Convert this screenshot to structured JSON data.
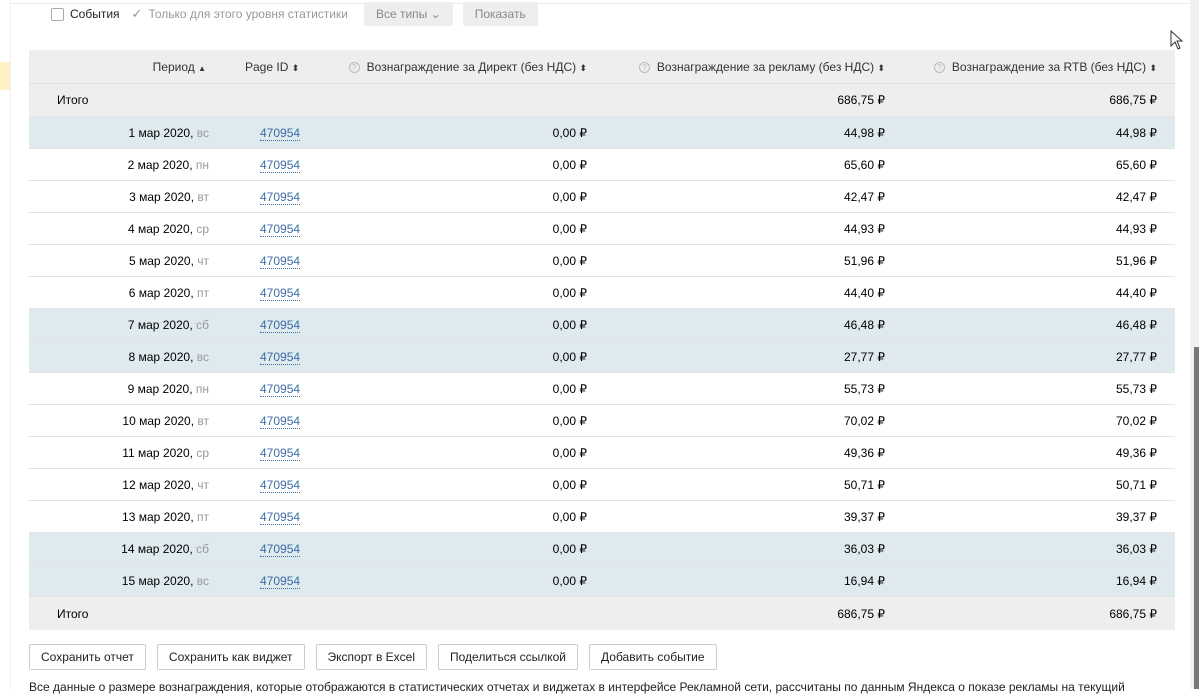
{
  "filters": {
    "events_label": "События",
    "only_level_label": "Только для этого уровня статистики",
    "types_select": "Все типы",
    "show_button": "Показать"
  },
  "table": {
    "headers": {
      "period": "Период",
      "page_id": "Page ID",
      "direct": "Вознаграждение за Директ (без НДС)",
      "ads": "Вознаграждение за рекламу (без НДС)",
      "rtb": "Вознаграждение за RTB (без НДС)"
    },
    "total": {
      "label": "Итого",
      "direct": "",
      "ads": "686,75 ₽",
      "rtb": "686,75 ₽"
    },
    "rows": [
      {
        "date": "1 мар 2020",
        "wd": "вс",
        "page_id": "470954",
        "direct": "0,00 ₽",
        "ads": "44,98 ₽",
        "rtb": "44,98 ₽",
        "weekend": true
      },
      {
        "date": "2 мар 2020",
        "wd": "пн",
        "page_id": "470954",
        "direct": "0,00 ₽",
        "ads": "65,60 ₽",
        "rtb": "65,60 ₽",
        "weekend": false
      },
      {
        "date": "3 мар 2020",
        "wd": "вт",
        "page_id": "470954",
        "direct": "0,00 ₽",
        "ads": "42,47 ₽",
        "rtb": "42,47 ₽",
        "weekend": false
      },
      {
        "date": "4 мар 2020",
        "wd": "ср",
        "page_id": "470954",
        "direct": "0,00 ₽",
        "ads": "44,93 ₽",
        "rtb": "44,93 ₽",
        "weekend": false
      },
      {
        "date": "5 мар 2020",
        "wd": "чт",
        "page_id": "470954",
        "direct": "0,00 ₽",
        "ads": "51,96 ₽",
        "rtb": "51,96 ₽",
        "weekend": false
      },
      {
        "date": "6 мар 2020",
        "wd": "пт",
        "page_id": "470954",
        "direct": "0,00 ₽",
        "ads": "44,40 ₽",
        "rtb": "44,40 ₽",
        "weekend": false
      },
      {
        "date": "7 мар 2020",
        "wd": "сб",
        "page_id": "470954",
        "direct": "0,00 ₽",
        "ads": "46,48 ₽",
        "rtb": "46,48 ₽",
        "weekend": true
      },
      {
        "date": "8 мар 2020",
        "wd": "вс",
        "page_id": "470954",
        "direct": "0,00 ₽",
        "ads": "27,77 ₽",
        "rtb": "27,77 ₽",
        "weekend": true
      },
      {
        "date": "9 мар 2020",
        "wd": "пн",
        "page_id": "470954",
        "direct": "0,00 ₽",
        "ads": "55,73 ₽",
        "rtb": "55,73 ₽",
        "weekend": false
      },
      {
        "date": "10 мар 2020",
        "wd": "вт",
        "page_id": "470954",
        "direct": "0,00 ₽",
        "ads": "70,02 ₽",
        "rtb": "70,02 ₽",
        "weekend": false
      },
      {
        "date": "11 мар 2020",
        "wd": "ср",
        "page_id": "470954",
        "direct": "0,00 ₽",
        "ads": "49,36 ₽",
        "rtb": "49,36 ₽",
        "weekend": false
      },
      {
        "date": "12 мар 2020",
        "wd": "чт",
        "page_id": "470954",
        "direct": "0,00 ₽",
        "ads": "50,71 ₽",
        "rtb": "50,71 ₽",
        "weekend": false
      },
      {
        "date": "13 мар 2020",
        "wd": "пт",
        "page_id": "470954",
        "direct": "0,00 ₽",
        "ads": "39,37 ₽",
        "rtb": "39,37 ₽",
        "weekend": false
      },
      {
        "date": "14 мар 2020",
        "wd": "сб",
        "page_id": "470954",
        "direct": "0,00 ₽",
        "ads": "36,03 ₽",
        "rtb": "36,03 ₽",
        "weekend": true
      },
      {
        "date": "15 мар 2020",
        "wd": "вс",
        "page_id": "470954",
        "direct": "0,00 ₽",
        "ads": "16,94 ₽",
        "rtb": "16,94 ₽",
        "weekend": true
      }
    ]
  },
  "actions": [
    "Сохранить отчет",
    "Сохранить как виджет",
    "Экспорт в Excel",
    "Поделиться ссылкой",
    "Добавить событие"
  ],
  "note": "Все данные о размере вознаграждения, которые отображаются в статистических отчетах и виджетах в интерфейсе Рекламной сети, рассчитаны по данным Яндекса о показе рекламы на текущий",
  "colors": {
    "weekend_row": "#dfeaef",
    "header_bg": "#eeeeee",
    "link": "#3a6ea5"
  }
}
